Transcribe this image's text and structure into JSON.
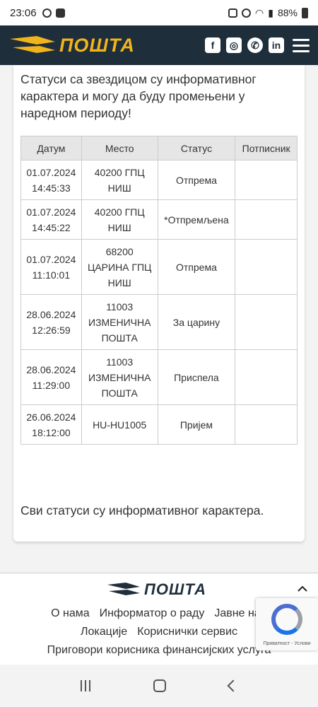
{
  "status_bar": {
    "time": "23:06",
    "battery": "88%"
  },
  "header": {
    "logo_text": "ПОШТА",
    "social_icons": [
      "facebook-icon",
      "instagram-icon",
      "viber-icon",
      "linkedin-icon"
    ]
  },
  "content": {
    "note": "Статуси са звездицом су информативног карактера и могу да буду промењени у наредном периоду!",
    "table": {
      "headers": [
        "Датум",
        "Место",
        "Статус",
        "Потписник"
      ],
      "rows": [
        {
          "date": "01.07.2024\n14:45:33",
          "place": "40200 ГПЦ\nНИШ",
          "status": "Отпрема",
          "signer": ""
        },
        {
          "date": "01.07.2024\n14:45:22",
          "place": "40200 ГПЦ\nНИШ",
          "status": "*Отпремљена",
          "signer": ""
        },
        {
          "date": "01.07.2024\n11:10:01",
          "place": "68200\nЦАРИНА ГПЦ\nНИШ",
          "status": "Отпрема",
          "signer": ""
        },
        {
          "date": "28.06.2024\n12:26:59",
          "place": "11003\nИЗМЕНИЧНА\nПОШТА",
          "status": "За царину",
          "signer": ""
        },
        {
          "date": "28.06.2024\n11:29:00",
          "place": "11003\nИЗМЕНИЧНА\nПОШТА",
          "status": "Приспела",
          "signer": ""
        },
        {
          "date": "26.06.2024\n18:12:00",
          "place": "HU-HU1005",
          "status": "Пријем",
          "signer": ""
        }
      ]
    },
    "footnote": "Сви статуси су информативног карактера."
  },
  "footer": {
    "logo_text": "ПОШТА",
    "links_row1": [
      "О нама",
      "Информатор о раду",
      "Јавне наб"
    ],
    "links_row2": [
      "Локације",
      "Кориснички сервис"
    ],
    "links_row3": [
      "Приговори корисника финансијских услуга"
    ],
    "recaptcha_text": "Приватност - Услови"
  },
  "colors": {
    "header_bg": "#1f2e3b",
    "brand_yellow": "#f2b41b"
  }
}
